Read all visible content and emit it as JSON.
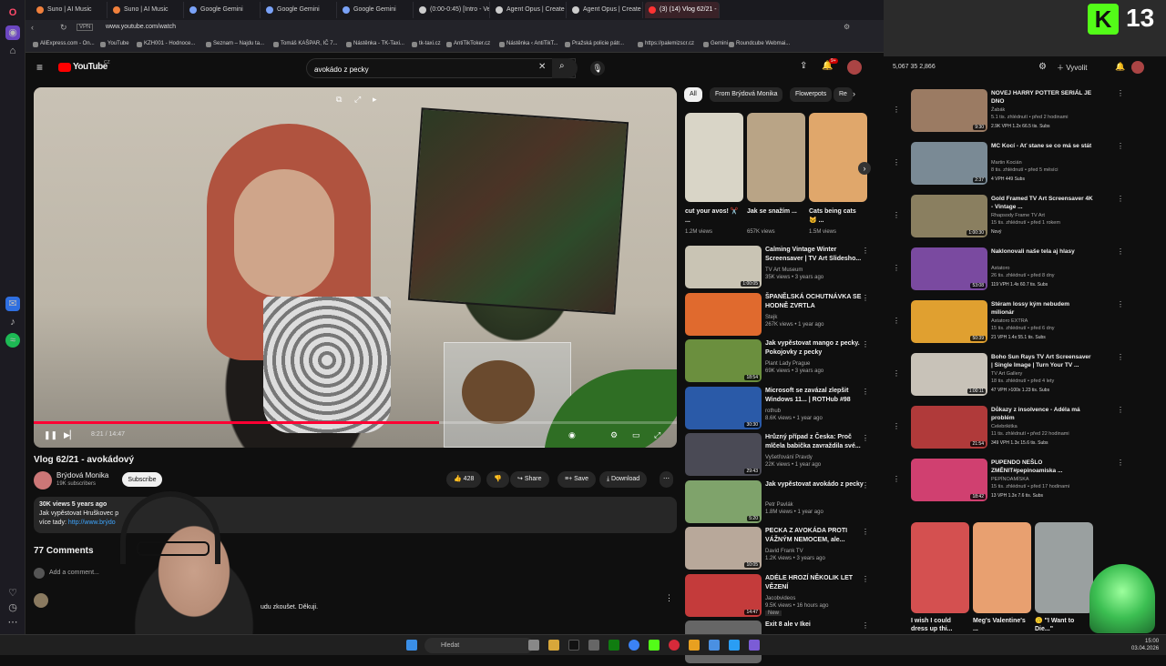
{
  "browser": {
    "tabs": [
      {
        "label": "Suno | AI Music",
        "color": "#f0803c"
      },
      {
        "label": "Suno | AI Music",
        "color": "#f0803c"
      },
      {
        "label": "Google Gemini",
        "color": "#7aa2f7"
      },
      {
        "label": "Google Gemini",
        "color": "#7aa2f7"
      },
      {
        "label": "Google Gemini",
        "color": "#7aa2f7"
      },
      {
        "label": "(0:00-0:45) [Intro - Vesel]",
        "color": "#cccccc"
      },
      {
        "label": "Agent Opus | Create vide",
        "color": "#cccccc"
      },
      {
        "label": "Agent Opus | Create vide",
        "color": "#cccccc"
      },
      {
        "label": "(3) (14) Vlog 62/21 - avo",
        "color": "#ff3333"
      }
    ],
    "url": "www.youtube.com/watch",
    "bookmarks": [
      "AliExpress.com - On...",
      "YouTube",
      "KZH001 - Hodnoce...",
      "Seznam – Najdu ta...",
      "Tomáš KAŠPAR, IČ 7...",
      "Nástěnka - TK-Taxi...",
      "tk-taxi.cz",
      "AntiTikToker.cz",
      "Nástěnka ‹ AntiTikT...",
      "Pražská policie pátr...",
      "https://palemizscr.cz",
      "Gemini",
      "Roundcube Webmai..."
    ]
  },
  "yt": {
    "logo": "YouTube",
    "logo_sup": "CZ",
    "search_value": "avokádo z pecky",
    "notif_count": "9+"
  },
  "video": {
    "time": "8:21 / 14:47",
    "progress": 0.63,
    "title": "Vlog 62/21 - avokádový",
    "channel": "Brýdová Monika",
    "subscribers": "19K subscribers",
    "subscribe": "Subscribe",
    "likes": "428",
    "share": "Share",
    "save": "Save",
    "download": "Download",
    "desc_meta": "30K views  5 years ago",
    "desc_line1": "Jak vypěstovat Hruškovec p",
    "desc_line2_prefix": "více tady:",
    "desc_line2_link": "http://www.brýdo",
    "comments_title": "77 Comments",
    "add_comment": "Add a comment...",
    "comment_snip": "udu zkoušet. Děkuji."
  },
  "chips": [
    "All",
    "From Brýdová Monika",
    "Flowerpots",
    "Re"
  ],
  "shorts": [
    {
      "title": "cut your avos! ✂️ ...",
      "views": "1.2M views",
      "color": "#d9d5c7"
    },
    {
      "title": "Jak se snažím ...",
      "views": "657K views",
      "color": "#b9a486"
    },
    {
      "title": "Cats being cats 🐱 ...",
      "views": "1.5M views",
      "color": "#e0a76b"
    }
  ],
  "related": [
    {
      "title": "Calming Vintage Winter Screensaver | TV Art Slidesho...",
      "channel": "TV Art Museum",
      "meta": "35K views • 3 years ago",
      "dur": "1:00:05",
      "color": "#c9c4b4"
    },
    {
      "title": "ŠPANĚLSKÁ OCHUTNÁVKA SE HODNĚ ZVRTLA",
      "channel": "Stejk",
      "meta": "267K views • 1 year ago",
      "dur": "",
      "color": "#e06a2e"
    },
    {
      "title": "Jak vypěstovat mango z pecky. Pokojovky z pecky",
      "channel": "Plant Lady Prague",
      "meta": "69K views • 3 years ago",
      "dur": "18:54",
      "color": "#6b8f3e"
    },
    {
      "title": "Microsoft se zavázal zlepšit Windows 11... | ROTHub #98",
      "channel": "rothub",
      "meta": "8.6K views • 1 year ago",
      "dur": "30:30",
      "color": "#2a5aa8"
    },
    {
      "title": "Hrůzný případ z Česka: Proč mlčela babička zavraždila své...",
      "channel": "Vyšetřování Pravdy",
      "meta": "22K views • 1 year ago",
      "dur": "29:43",
      "color": "#4a4a55"
    },
    {
      "title": "Jak vypěstovat avokádo z pecky",
      "channel": "Petr Pavlák",
      "meta": "1.8M views • 1 year ago",
      "dur": "5:20",
      "color": "#7fa36b"
    },
    {
      "title": "PECKA Z AVOKÁDA PROTI VÁŽNÝM NEMOCEM, ale... ",
      "channel": "David Frank TV",
      "meta": "1.2K views • 3 years ago",
      "dur": "10:05",
      "color": "#b8a89a"
    },
    {
      "title": "ADÉLE HROZÍ NĚKOLIK LET VĚZENÍ",
      "channel": "Jacobvideos",
      "meta": "9.5K views • 16 hours ago",
      "dur": "14:47",
      "color": "#c43b3b",
      "badge": "New"
    },
    {
      "title": "Exit 8 ale v Ikei",
      "channel": "",
      "meta": "",
      "dur": "",
      "color": "#666"
    }
  ],
  "right": {
    "stats": "5,067  35  2,866",
    "upload": "Vyvolit",
    "kick_letter": "K",
    "kick_num": "13",
    "items": [
      {
        "title": "NOVEJ HARRY POTTER SERIÁL JE DNO",
        "channel": "Žabák",
        "meta": "5.1 tis. zhlédnutí • před 2 hodinami",
        "badge": "2.9K VPH   1.2x   66.5 tis. Subs",
        "dur": "9:30",
        "color": "#9b7b63"
      },
      {
        "title": "MC Kocí - Ať stane se co má se stát",
        "channel": "Martin Kocián",
        "meta": "8 tis. zhlédnutí • před 5 měsíci",
        "badge": "4 VPH   449 Subs",
        "dur": "2:37",
        "color": "#7a8a95"
      },
      {
        "title": "Gold Framed TV Art Screensaver 4K - Vintage ...",
        "channel": "Rhapsody Frame TV Art",
        "meta": "15 tis. zhlédnutí • před 1 rokem",
        "badge": "Nový",
        "dur": "1:00:30",
        "color": "#8a7f60"
      },
      {
        "title": "Naklonovali naše tela aj hlasy",
        "channel": "Astatoro",
        "meta": "26 tis. zhlédnutí • před 8 dny",
        "badge": "119 VPH   1.4x   60.7 tis. Subs",
        "dur": "53:08",
        "color": "#7a4aa0"
      },
      {
        "title": "Stéram lossy kým nebudem milionár",
        "channel": "Astatoro EXTRA",
        "meta": "15 tis. zhlédnutí • před 6 dny",
        "badge": "21 VPH   1.4x   55.1 tis. Subs",
        "dur": "50:39",
        "color": "#e0a030"
      },
      {
        "title": "Boho Sun Rays TV Art Screensaver | Single Image | Turn Your TV ...",
        "channel": "TV Art Gallery",
        "meta": "18 tis. zhlédnutí • před 4 lety",
        "badge": "47 VPH   >100x   1.23 tis. Subs",
        "dur": "1:00:11",
        "color": "#c8c2b8"
      },
      {
        "title": "Důkazy z insolvence - Adéla má problém",
        "channel": "Celebrikitka",
        "meta": "11 tis. zhlédnutí • před 22 hodinami",
        "badge": "349 VPH   1.3x   15.6 tis. Subs",
        "dur": "21:54",
        "color": "#b03a3a"
      },
      {
        "title": "PUPENDO  NEŠLO ZMĚNIT#pepinoamiska ...",
        "channel": "PEPÍNOAMÍSKA",
        "meta": "15 tis. zhlédnutí • před 17 hodinami",
        "badge": "13 VPH   1.3x   7.6 tis. Subs",
        "dur": "18:42",
        "color": "#d04070"
      }
    ],
    "shorts": [
      {
        "title": "I wish I could dress up thi...",
        "color": "#d45050"
      },
      {
        "title": "Meg's Valentine's ...",
        "color": "#e8a070"
      },
      {
        "title": "🙃 \"I Want to Die...\"",
        "color": "#9aa0a0"
      }
    ]
  },
  "taskbar": {
    "search": "Hledat",
    "time": "15:00",
    "date": "03.04.2026"
  }
}
